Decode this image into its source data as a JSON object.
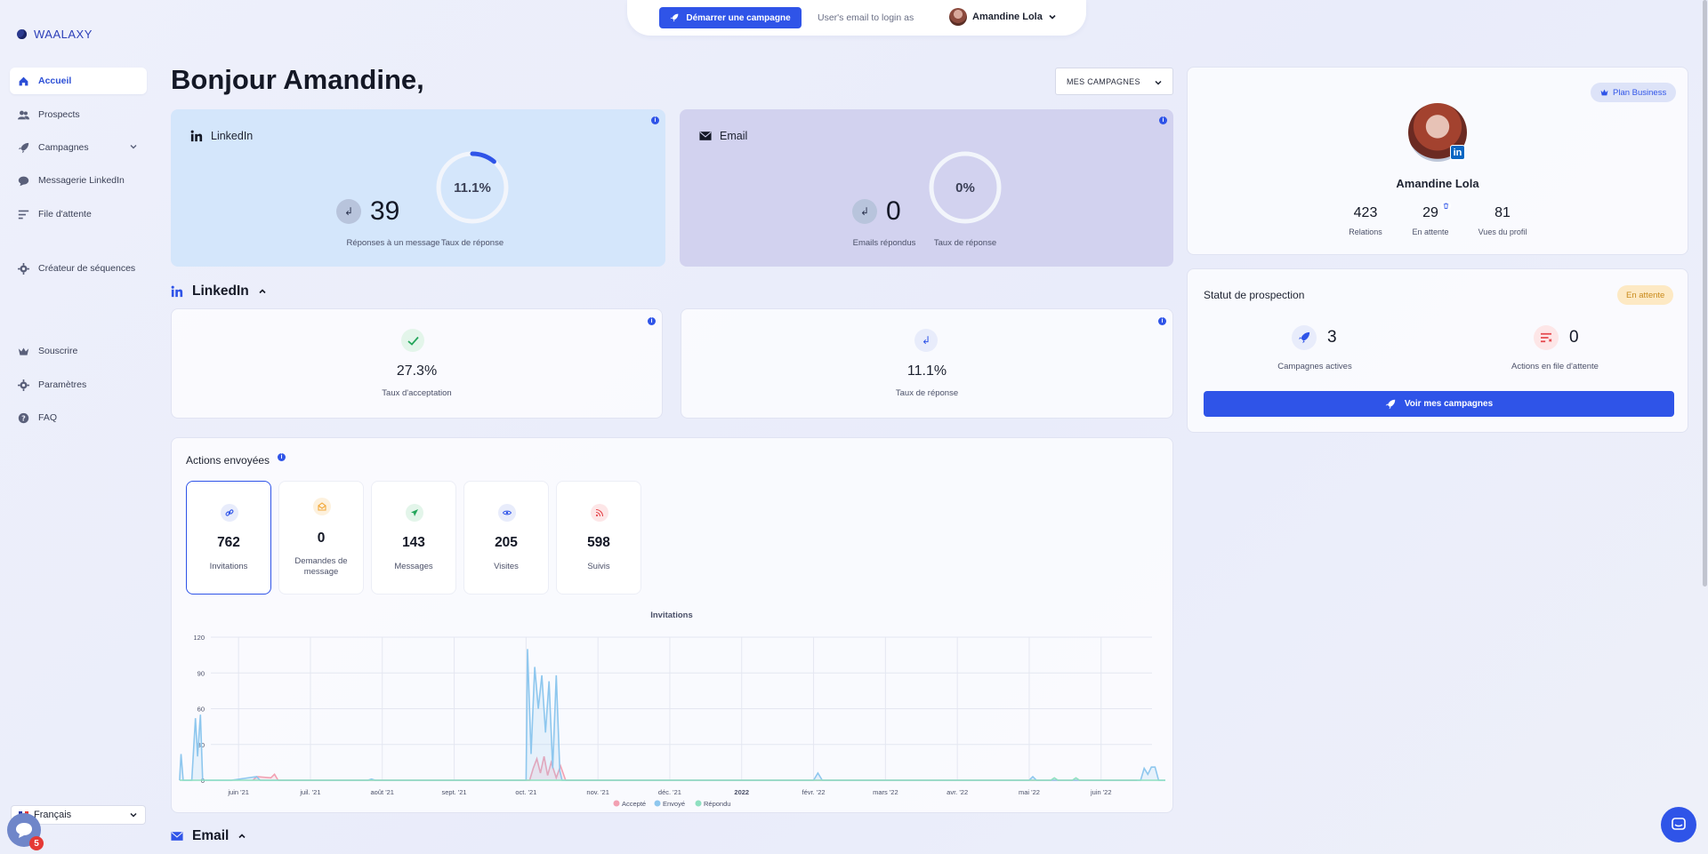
{
  "app": {
    "brand": "WAALAXY"
  },
  "sidebar": {
    "items": [
      {
        "label": "Accueil",
        "icon": "home-icon",
        "active": true
      },
      {
        "label": "Prospects",
        "icon": "users-icon"
      },
      {
        "label": "Campagnes",
        "icon": "rocket-icon",
        "has_chevron": true
      },
      {
        "label": "Messagerie LinkedIn",
        "icon": "chat-icon"
      },
      {
        "label": "File d'attente",
        "icon": "queue-icon"
      },
      {
        "label": "Créateur de séquences",
        "icon": "gear-icon"
      },
      {
        "label": "Souscrire",
        "icon": "crown-icon"
      },
      {
        "label": "Paramètres",
        "icon": "gear-icon"
      },
      {
        "label": "FAQ",
        "icon": "question-icon"
      }
    ],
    "language": "Français",
    "notification_count": "5"
  },
  "topbar": {
    "start_campaign": "Démarrer une campagne",
    "email_login_label": "User's email to login as",
    "user_name": "Amandine Lola"
  },
  "main": {
    "greeting": "Bonjour Amandine,",
    "campaign_filter": "MES CAMPAGNES",
    "linkedin_card": {
      "title": "LinkedIn",
      "responses_value": "39",
      "responses_label": "Réponses à un message",
      "rate_value": "11.1%",
      "rate_fraction": 0.111,
      "rate_label": "Taux de réponse"
    },
    "email_card": {
      "title": "Email",
      "responses_value": "0",
      "responses_label": "Emails répondus",
      "rate_value": "0%",
      "rate_fraction": 0,
      "rate_label": "Taux de réponse"
    },
    "linkedin_section": {
      "title": "LinkedIn",
      "acceptance_value": "27.3%",
      "acceptance_label": "Taux d'acceptation",
      "response_value": "11.1%",
      "response_label": "Taux de réponse"
    },
    "actions": {
      "title": "Actions envoyées",
      "tiles": [
        {
          "value": "762",
          "label": "Invitations",
          "icon": "link-icon",
          "color": "#2f54e8",
          "bg": "#e8ecfb"
        },
        {
          "value": "0",
          "label": "Demandes de message",
          "icon": "mail-open-icon",
          "color": "#f2a93b",
          "bg": "#fdf1dd"
        },
        {
          "value": "143",
          "label": "Messages",
          "icon": "send-icon",
          "color": "#23a55a",
          "bg": "#e3f5ea"
        },
        {
          "value": "205",
          "label": "Visites",
          "icon": "eye-icon",
          "color": "#2f54e8",
          "bg": "#e8ecfb"
        },
        {
          "value": "598",
          "label": "Suivis",
          "icon": "rss-icon",
          "color": "#e5484d",
          "bg": "#fde6e7"
        }
      ]
    },
    "email_section": {
      "title": "Email"
    }
  },
  "chart_data": {
    "type": "area",
    "title": "Invitations",
    "x_tick_labels": [
      "juin '21",
      "juil. '21",
      "août '21",
      "sept. '21",
      "oct. '21",
      "nov. '21",
      "déc. '21",
      "2022",
      "févr. '22",
      "mars '22",
      "avr. '22",
      "mai '22",
      "juin '22"
    ],
    "ylim": [
      0,
      120
    ],
    "y_ticks": [
      0,
      30,
      60,
      90,
      120
    ],
    "grid": true,
    "legend_position": "bottom",
    "series": [
      {
        "name": "Accepté",
        "color": "#f2a0b2",
        "points": [
          [
            0.2,
            0
          ],
          [
            0.25,
            3
          ],
          [
            0.45,
            2
          ],
          [
            0.5,
            5
          ],
          [
            0.55,
            0
          ],
          [
            4.05,
            0
          ],
          [
            4.1,
            10
          ],
          [
            4.15,
            18
          ],
          [
            4.2,
            6
          ],
          [
            4.25,
            20
          ],
          [
            4.3,
            4
          ],
          [
            4.35,
            15
          ],
          [
            4.42,
            2
          ],
          [
            4.48,
            12
          ],
          [
            4.55,
            0
          ],
          [
            12.5,
            0
          ]
        ]
      },
      {
        "name": "Envoyé",
        "color": "#8ec7ee",
        "points": [
          [
            -0.82,
            0
          ],
          [
            -0.8,
            22
          ],
          [
            -0.77,
            0
          ],
          [
            -0.65,
            0
          ],
          [
            -0.6,
            52
          ],
          [
            -0.57,
            20
          ],
          [
            -0.53,
            55
          ],
          [
            -0.5,
            0
          ],
          [
            -0.1,
            0
          ],
          [
            0.25,
            3
          ],
          [
            0.3,
            0
          ],
          [
            1.8,
            0
          ],
          [
            1.85,
            1
          ],
          [
            1.9,
            0
          ],
          [
            4.0,
            0
          ],
          [
            4.02,
            110
          ],
          [
            4.07,
            22
          ],
          [
            4.12,
            95
          ],
          [
            4.17,
            60
          ],
          [
            4.22,
            88
          ],
          [
            4.27,
            40
          ],
          [
            4.32,
            83
          ],
          [
            4.37,
            10
          ],
          [
            4.42,
            88
          ],
          [
            4.47,
            8
          ],
          [
            4.5,
            0
          ],
          [
            8.0,
            0
          ],
          [
            8.06,
            6
          ],
          [
            8.12,
            0
          ],
          [
            11.0,
            0
          ],
          [
            11.05,
            3
          ],
          [
            11.1,
            0
          ],
          [
            12.55,
            0
          ],
          [
            12.6,
            10
          ],
          [
            12.65,
            5
          ],
          [
            12.7,
            11
          ],
          [
            12.75,
            11
          ],
          [
            12.8,
            0
          ],
          [
            13.1,
            0
          ],
          [
            13.14,
            9
          ],
          [
            13.18,
            0
          ],
          [
            13.3,
            0
          ]
        ]
      },
      {
        "name": "Répondu",
        "color": "#8fe0c0",
        "points": [
          [
            -0.82,
            0
          ],
          [
            11.3,
            0
          ],
          [
            11.35,
            2
          ],
          [
            11.4,
            0
          ],
          [
            11.6,
            0
          ],
          [
            11.65,
            2
          ],
          [
            11.7,
            0
          ],
          [
            13.3,
            0
          ]
        ]
      }
    ]
  },
  "profile": {
    "plan": "Plan Business",
    "name": "Amandine Lola",
    "relations_value": "423",
    "relations_label": "Relations",
    "pending_value": "29",
    "pending_label": "En attente",
    "views_value": "81",
    "views_label": "Vues du profil"
  },
  "prospection": {
    "title": "Statut de prospection",
    "status": "En attente",
    "active_campaigns_value": "3",
    "active_campaigns_label": "Campagnes actives",
    "queue_actions_value": "0",
    "queue_actions_label": "Actions en file d'attente",
    "button": "Voir mes campagnes"
  },
  "colors": {
    "accent": "#2f54e8",
    "linkedin_card": "#d4e6fb",
    "email_card": "#d2d2ef"
  }
}
